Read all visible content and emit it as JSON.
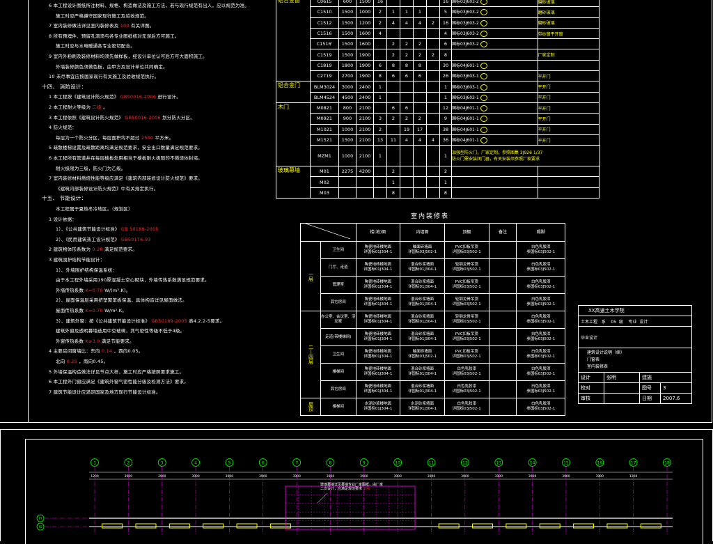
{
  "notes": [
    {
      "num": "6",
      "text": "本工程设计图纸所注材料、规格、构造做法及施工方法，若与现行规范有出入，应以规范为准。"
    },
    {
      "num": "",
      "text": "施工时应严格遵守国家现行施工及验收规范。"
    },
    {
      "num": "7",
      "text": "室内装修做法详见室内装修表及",
      "red": "100",
      "rest": "有关详图。"
    },
    {
      "num": "8",
      "text": "所有预埋件、预留孔洞须与各专业图纸核对无误后方可施工。"
    },
    {
      "num": "",
      "text": "施工时应与水电暖通各专业密切配合。"
    },
    {
      "num": "9",
      "text": "室内外粉刷及装修材料均须先做样板，经设计单位认可后方可大面积施工。"
    },
    {
      "num": "",
      "text": "外墙装修颜色须做色板，由甲方及设计单位共同确定。"
    },
    {
      "num": "10",
      "text": "未尽事宜应按国家现行有关施工及验收规范执行。"
    },
    {
      "num": "十四、",
      "text": "消防设计："
    },
    {
      "num": "1",
      "text": "本工程按《建筑设计防火规范》",
      "red": "GB50016-2006",
      "rest": "进行设计。"
    },
    {
      "num": "2",
      "text": "本工程耐火等级为",
      "red": "二级",
      "rest": "。"
    },
    {
      "num": "3",
      "text": "本工程依照《建筑设计防火规范》",
      "red": "GB50016-2006",
      "rest": "划分防火分区。"
    },
    {
      "num": "4",
      "text": "防火规范："
    },
    {
      "num": "",
      "text": "每层为一个防火分区，每层面积均不超过",
      "red": "2500",
      "rest": "平方米。"
    },
    {
      "num": "5",
      "text": "疏散楼梯设置及疏散距离均满足规范要求，安全出口数量满足规范要求。"
    },
    {
      "num": "6",
      "text": "本工程所有管道井在每层楼板处用相当于楼板耐火极限的不燃烧体封堵。"
    },
    {
      "num": "",
      "text": "耐火极限为三级，防火门为乙级。"
    },
    {
      "num": "7",
      "text": "室内装修材料燃烧性能等级应满足《建筑内部装修设计防火规范》要求。"
    },
    {
      "num": "",
      "text": "《建筑内部装修设计防火规范》中有关规定执行。"
    },
    {
      "num": "十五、",
      "text": "节能设计："
    },
    {
      "num": "",
      "text": "本工程属于夏热冬冷地区。（规划区）"
    },
    {
      "num": "1",
      "text": "设计依据："
    },
    {
      "num": "",
      "text": "1）、《公共建筑节能设计标准》",
      "red": "GB 50189-2005",
      "rest": ""
    },
    {
      "num": "",
      "text": "2）、《民用建筑热工设计规范》",
      "red": "GB50176-93",
      "rest": ""
    },
    {
      "num": "2",
      "text": "建筑物体形系数为",
      "red": "0.28",
      "rest": "满足规范要求。"
    },
    {
      "num": "3",
      "text": "建筑围护结构节能设计："
    },
    {
      "num": "",
      "text": "1）、外墙围护结构保温系统："
    },
    {
      "num": "",
      "text": "由于本工程外墙采用190厚混凝土空心砌块，外墙传热系数满足规范要求。"
    },
    {
      "num": "",
      "text": "外墙传热系数",
      "red": "K=0.70",
      "rest": "W/(m².K)。"
    },
    {
      "num": "",
      "text": "2）、屋面保温层采用挤塑聚苯板保温，具体构造详见屋面做法。"
    },
    {
      "num": "",
      "text": "屋面传热系数",
      "red": "K=0.70",
      "rest": "W/m².K。"
    },
    {
      "num": "",
      "text": "3）、建筑外窗：按《公共建筑节能设计标准》",
      "red": "GB50189-2005",
      "rest": "表4.2.2-5要求。"
    },
    {
      "num": "",
      "text": "建筑外窗及透明幕墙选用中空玻璃，其气密性等级不低于4级。"
    },
    {
      "num": "",
      "text": "外窗传热系数",
      "red": "K≤3.0",
      "rest": "满足节能要求。"
    },
    {
      "num": "4",
      "text": "主要房间窗墙比：东向",
      "red": "0.14",
      "rest": "，西向0.05。"
    },
    {
      "num": "",
      "text": "北向",
      "red": "0.25",
      "rest": "，南向0.45。"
    },
    {
      "num": "5",
      "text": "外墙保温构造做法详见节点大样，施工时应严格按照要求施工。"
    },
    {
      "num": "6",
      "text": "本工程外门窗应满足《建筑外窗气密性能分级及检测方法》要求。"
    },
    {
      "num": "7",
      "text": "建筑节能设计应满足国家及地方现行节能设计标准。"
    }
  ],
  "door_table": {
    "rows": [
      {
        "group": "铝合金窗",
        "code": "C0615",
        "w": "600",
        "h": "1500",
        "c1": "16",
        "c2": "",
        "c3": "",
        "c4": "",
        "c5": "",
        "total": "16",
        "ref": "国标03J603-2",
        "note": "磨砂玻璃"
      },
      {
        "group": "",
        "code": "C1510",
        "w": "1500",
        "h": "1000",
        "c1": "2",
        "c2": "1",
        "c3": "1",
        "c4": "1",
        "c5": "",
        "total": "5",
        "ref": "国标03J603-2",
        "note": "磨砂玻璃"
      },
      {
        "group": "",
        "code": "C1512",
        "w": "1500",
        "h": "1200",
        "c1": "2",
        "c2": "4",
        "c3": "4",
        "c4": "4",
        "c5": "2",
        "total": "16",
        "ref": "国标03J603-2",
        "note": "磨砂玻璃"
      },
      {
        "group": "",
        "code": "C1516",
        "w": "1500",
        "h": "1600",
        "c1": "4",
        "c2": "",
        "c3": "",
        "c4": "",
        "c5": "",
        "total": "4",
        "ref": "国标03J603-2",
        "note": "带纱窗平开窗"
      },
      {
        "group": "",
        "code": "C1516'",
        "w": "1500",
        "h": "1600",
        "c1": "",
        "c2": "2",
        "c3": "2",
        "c4": "2",
        "c5": "",
        "total": "6",
        "ref": "国标03J603-2",
        "note": ""
      },
      {
        "group": "",
        "code": "C1519",
        "w": "1500",
        "h": "1900",
        "c1": "",
        "c2": "2",
        "c3": "2",
        "c4": "2",
        "c5": "2",
        "total": "8",
        "ref": "",
        "note": "厂家定制"
      },
      {
        "group": "",
        "code": "C1819",
        "w": "1800",
        "h": "1900",
        "c1": "6",
        "c2": "8",
        "c3": "8",
        "c4": "8",
        "c5": "",
        "total": "30",
        "ref": "国标04J601-1",
        "note": ""
      },
      {
        "group": "",
        "code": "C2719",
        "w": "2700",
        "h": "1900",
        "c1": "8",
        "c2": "6",
        "c3": "6",
        "c4": "6",
        "c5": "",
        "total": "26",
        "ref": "国标03J603-1",
        "note": "平开门"
      },
      {
        "group": "铝合金门",
        "code": "BLM3024",
        "w": "3000",
        "h": "2400",
        "c1": "1",
        "c2": "",
        "c3": "",
        "c4": "",
        "c5": "",
        "total": "1",
        "ref": "国标03J603-1",
        "note": "平开门"
      },
      {
        "group": "",
        "code": "BLM4524",
        "w": "4500",
        "h": "2400",
        "c1": "1",
        "c2": "",
        "c3": "",
        "c4": "",
        "c5": "",
        "total": "1",
        "ref": "国标03J603-1",
        "note": "平开门"
      },
      {
        "group": "木门",
        "code": "M0821",
        "w": "800",
        "h": "2100",
        "c1": "",
        "c2": "6",
        "c3": "6",
        "c4": "",
        "c5": "",
        "total": "12",
        "ref": "国标04J601-1",
        "note": "平开门"
      },
      {
        "group": "",
        "code": "M0921",
        "w": "900",
        "h": "2100",
        "c1": "3",
        "c2": "2",
        "c3": "2",
        "c4": "2",
        "c5": "",
        "total": "9",
        "ref": "国标04J601-1",
        "note": "平开门"
      },
      {
        "group": "",
        "code": "M1021",
        "w": "1000",
        "h": "2100",
        "c1": "2",
        "c2": "",
        "c3": "19",
        "c4": "17",
        "c5": "",
        "total": "38",
        "ref": "国标04J601-1",
        "note": "平开门"
      },
      {
        "group": "",
        "code": "M1521",
        "w": "1500",
        "h": "2100",
        "c1": "13",
        "c2": "11",
        "c3": "4",
        "c4": "4",
        "c5": "4",
        "total": "36",
        "ref": "国标04J601-1",
        "note": "平开门"
      },
      {
        "group": "",
        "code": "MZM1",
        "w": "1000",
        "h": "2100",
        "c1": "1",
        "c2": "",
        "c3": "",
        "c4": "",
        "c5": "",
        "total": "1",
        "ref": "",
        "note": ""
      },
      {
        "group": "玻璃幕墙",
        "code": "M01",
        "w": "2275",
        "h": "4200",
        "c1": "",
        "c2": "2",
        "c3": "",
        "c4": "",
        "c5": "",
        "total": "2",
        "ref": "",
        "note": ""
      },
      {
        "group": "",
        "code": "M02",
        "w": "",
        "h": "",
        "c1": "",
        "c2": "1",
        "c3": "",
        "c4": "",
        "c5": "",
        "total": "1",
        "ref": "",
        "note": ""
      },
      {
        "group": "",
        "code": "M03",
        "w": "",
        "h": "",
        "c1": "",
        "c2": "8",
        "c3": "",
        "c4": "",
        "c5": "",
        "total": "8",
        "ref": "",
        "note": ""
      }
    ],
    "mzm_note_1": "加强型防火门，厂家定制，参照图集 3J926 1/37",
    "mzm_note_2": "防火门需安装闭门器，有关安装须参照厂家要求"
  },
  "finish_table": {
    "title": "室内装修表",
    "headers": [
      "部位",
      "楼(地)面",
      "内墙面",
      "顶棚",
      "备注",
      "踢脚"
    ],
    "floor1_label": "一层",
    "floor2_label": "二—四层",
    "roof_label": "屋顶",
    "rows": [
      {
        "room": "卫生间",
        "floor": "陶瓷地砖楼地面\n详国标01J304-1",
        "wall": "釉面砖墙面\n详国标03J502-1",
        "ceiling": "PVC扣板吊顶\n详国标03J502-1",
        "base": "白色乳胶漆\n参国标03J502-1"
      },
      {
        "room": "门厅、走道",
        "floor": "陶瓷地砖楼地面\n详国标01J304-1",
        "wall": "混合砂浆墙面\n详国标01J304-1",
        "ceiling": "轻钢龙骨吊顶\n详国标03J502-1",
        "base": "白色乳胶漆\n参国标03J502-1"
      },
      {
        "room": "管理室",
        "floor": "陶瓷地砖楼地面\n详国标01J304-1",
        "wall": "混合砂浆墙面\n详国标01J304-1",
        "ceiling": "PVC扣板吊顶\n详国标03J502-1",
        "base": "白色乳胶漆\n参国标03J502-1"
      },
      {
        "room": "其它房间",
        "floor": "陶瓷地砖楼地面\n详国标01J304-1",
        "wall": "混合砂浆墙面\n详国标01J304-1",
        "ceiling": "轻钢龙骨吊顶\n详国标03J502-1",
        "base": "白色乳胶漆\n参国标03J502-1"
      },
      {
        "room": "办公室、会议室、活动室",
        "floor": "陶瓷地砖楼地面\n详国标01J304-1",
        "wall": "混合砂浆墙面\n详国标01J304-1",
        "ceiling": "轻钢龙骨吊顶\n详国标03J502-1",
        "base": "白色乳胶漆\n参国标03J502-1"
      },
      {
        "room": "走道(带楼梯间)",
        "floor": "陶瓷地砖楼地面\n详国标01J304-1",
        "wall": "混合砂浆墙面\n详国标01J304-1",
        "ceiling": "PVC扣板吊顶\n详国标03J502-1",
        "base": "白色乳胶漆\n参国标03J502-1"
      },
      {
        "room": "卫生间",
        "floor": "陶瓷地砖楼地面\n详国标01J304-1",
        "wall": "釉面砖墙面\n详国标03J502-1",
        "ceiling": "PVC扣板吊顶\n详国标03J502-1",
        "base": "白色乳胶漆\n参国标03J502-1"
      },
      {
        "room": "楼梯间",
        "floor": "陶瓷地砖楼地面\n详国标01J304-1",
        "wall": "混合砂浆墙面\n详国标01J304-1",
        "ceiling": "白色乳胶漆\n详国标03J502-1",
        "base": "白色乳胶漆\n参国标03J502-1"
      },
      {
        "room": "其它房间",
        "floor": "陶瓷地砖楼地面\n详国标01J304-1",
        "wall": "混合砂浆墙面\n详国标01J304-1",
        "ceiling": "白色乳胶漆\n详国标03J502-1",
        "base": "白色乳胶漆\n参国标03J502-1"
      },
      {
        "room": "楼梯间",
        "floor": "水泥砂浆楼地面\n详国标01J304-1",
        "wall": "水泥砂浆墙面\n详国标01J304-1",
        "ceiling": "白色乳胶漆\n详国标03J502-1",
        "base": "白色乳胶漆\n参国标03J502-1"
      }
    ]
  },
  "title_block": {
    "company": "XX高速土木学院",
    "project_row": [
      "土木工程",
      "系",
      "05",
      "级",
      "专业",
      "设计"
    ],
    "subject": "毕业设计",
    "drawing_title_1": "建筑设计说明（续）",
    "drawing_title_2": "门窗表",
    "drawing_title_3": "室内装修表",
    "design_label": "设计",
    "design_value": "张明",
    "design_extra": "建施",
    "check_label": "校对",
    "check_value": "图号",
    "check_number": "3",
    "approve_label": "审核",
    "date_label": "日期",
    "date_value": "2007.6"
  },
  "plan": {
    "axis_labels": [
      "1",
      "2",
      "3",
      "4",
      "5",
      "6",
      "7",
      "8",
      "9",
      "10",
      "11",
      "12",
      "13",
      "14",
      "15",
      "16",
      "17",
      "18"
    ],
    "dims": [
      "1200",
      "3900",
      "3900",
      "3900",
      "3900",
      "3900",
      "3900",
      "3900",
      "3900",
      "3900",
      "3900",
      "3900",
      "3900",
      "3900",
      "3900",
      "3900",
      "1200"
    ],
    "annotation": "玻璃幕墙详见幕墙专业厂家图纸，由厂家二次设计，应满足规范要求",
    "annotation_ref": "100",
    "left_axes": [
      "H",
      "G"
    ]
  },
  "colors": {
    "background": "#000000",
    "line": "#ffffff",
    "accent_yellow": "#ffff00",
    "accent_red": "#ee3333",
    "accent_green": "#00ff00",
    "accent_magenta": "#ff00ff"
  }
}
